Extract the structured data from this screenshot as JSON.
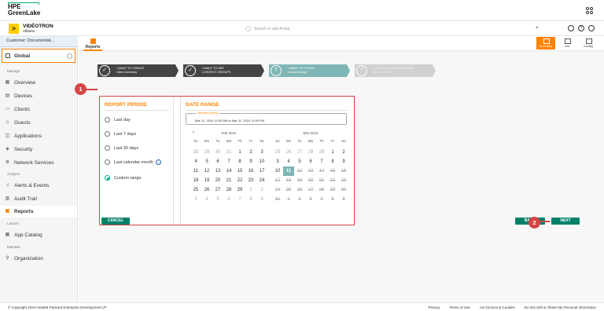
{
  "brand": {
    "logo_line1": "HPE",
    "logo_line2": "GreenLake",
    "company": "VIDÉOTRON",
    "company_sub": "Affaires",
    "company_mark": ">"
  },
  "search": {
    "placeholder": "Search or ask Aruba"
  },
  "customer": "Customer: Documentat...",
  "scope": "Global",
  "sidebar": {
    "manage_label": "Manage",
    "analyze_label": "Analyze",
    "launch_label": "Launch",
    "maintain_label": "Maintain",
    "items": [
      {
        "label": "Overview"
      },
      {
        "label": "Devices"
      },
      {
        "label": "Clients"
      },
      {
        "label": "Guests"
      },
      {
        "label": "Applications"
      },
      {
        "label": "Security"
      },
      {
        "label": "Network Services"
      },
      {
        "label": "Alerts & Events"
      },
      {
        "label": "Audit Trail"
      },
      {
        "label": "Reports"
      },
      {
        "label": "App Catalog"
      },
      {
        "label": "Organization"
      }
    ]
  },
  "subnav": {
    "tab": "Reports",
    "tools": [
      "Summary",
      "List",
      "Config"
    ]
  },
  "steps": [
    {
      "title": "I WANT TO CREATE",
      "sub": "Client inventory"
    },
    {
      "title": "I WANT TO SEE",
      "sub": "CONTEXT: GROUPS"
    },
    {
      "title": "I WANT TO COVER",
      "sub": "Custom range"
    },
    {
      "title": "I WANT TO SCHEDULE NOW",
      "sub": "Mar 11, 2024"
    }
  ],
  "report_period": {
    "heading": "REPORT PERIOD",
    "options": [
      "Last day",
      "Last 7 days",
      "Last 30 days",
      "Last calendar month",
      "Custom range"
    ],
    "selected": "Custom range"
  },
  "date_range": {
    "heading": "DATE RANGE",
    "field_label": "Selected period",
    "field_value": "Mar 11, 2024 12:00 AM to Mar 11, 2024 11:59 PM",
    "weekdays": [
      "Su",
      "Mo",
      "Tu",
      "We",
      "Th",
      "Fr",
      "Sa"
    ],
    "months": [
      {
        "name": "Feb 2024",
        "days": [
          "28",
          "29",
          "30",
          "31",
          "1",
          "2",
          "3",
          "4",
          "5",
          "6",
          "7",
          "8",
          "9",
          "10",
          "11",
          "12",
          "13",
          "14",
          "15",
          "16",
          "17",
          "18",
          "19",
          "20",
          "21",
          "22",
          "23",
          "24",
          "25",
          "26",
          "27",
          "28",
          "29",
          "1",
          "2",
          "3",
          "4",
          "5",
          "6",
          "7",
          "8",
          "9"
        ]
      },
      {
        "name": "Mar 2024",
        "days": [
          "25",
          "26",
          "27",
          "28",
          "29",
          "1",
          "2",
          "3",
          "4",
          "5",
          "6",
          "7",
          "8",
          "9",
          "10",
          "11",
          "12",
          "13",
          "14",
          "15",
          "16",
          "17",
          "18",
          "19",
          "20",
          "21",
          "22",
          "23",
          "24",
          "25",
          "26",
          "27",
          "28",
          "29",
          "30",
          "31",
          "1",
          "2",
          "3",
          "4",
          "5",
          "6"
        ]
      }
    ],
    "selected_day": "11"
  },
  "buttons": {
    "cancel": "CANCEL",
    "back": "BACK",
    "next": "NEXT"
  },
  "markers": [
    "1",
    "2"
  ],
  "footer": {
    "copyright": "© Copyright 2024 Hewlett Packard Enterprise Development LP",
    "links": [
      "Privacy",
      "Terms of Use",
      "Ad Choices & Cookies",
      "Do Not Sell or Share My Personal Information"
    ]
  },
  "colors": {
    "accent": "#ff8300",
    "primary_button": "#01806a",
    "marker": "#d64545",
    "selected_day": "#7fb5b5"
  }
}
